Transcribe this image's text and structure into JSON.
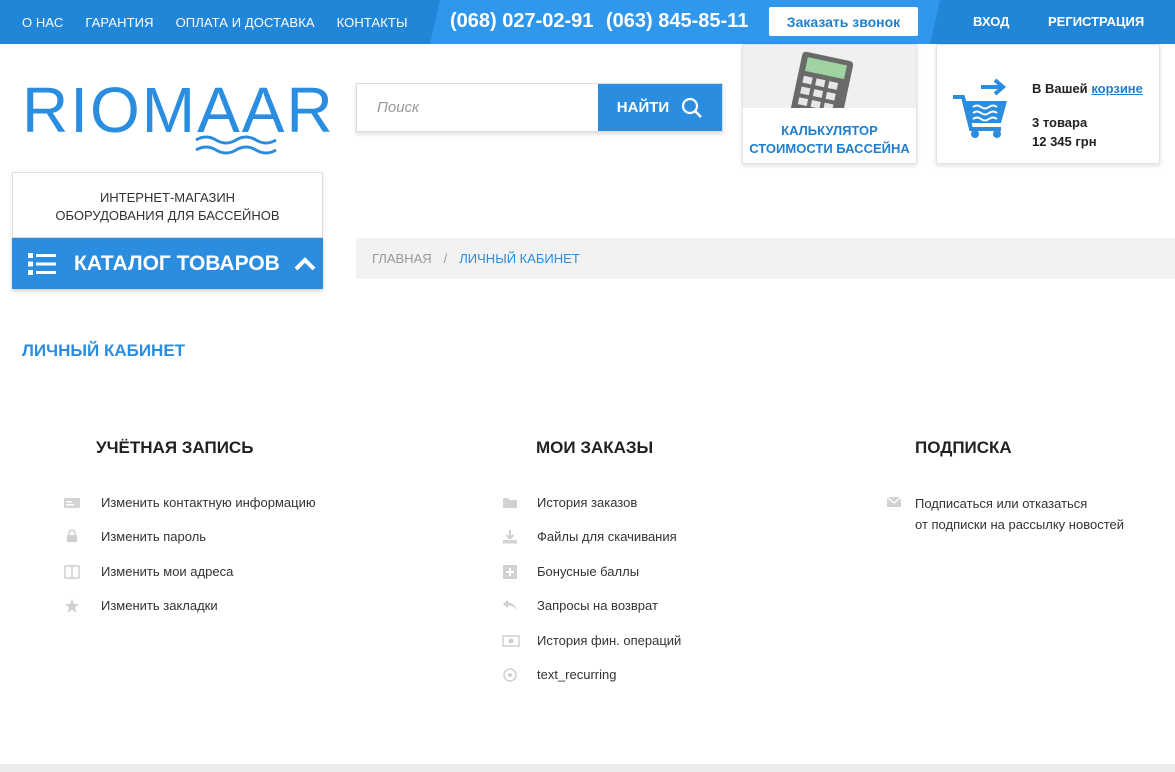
{
  "topbar": {
    "menu": [
      "О НАС",
      "ГАРАНТИЯ",
      "ОПЛАТА И ДОСТАВКА",
      "КОНТАКТЫ"
    ],
    "phone1": "(068) 027-02-91",
    "phone2": "(063) 845-85-11",
    "callback_label": "Заказать звонок",
    "login_label": "ВХОД",
    "register_label": "РЕГИСТРАЦИЯ",
    "color": "#2186d8"
  },
  "logo": {
    "text": "RIOMAAR"
  },
  "shop_description": {
    "line1": "ИНТЕРНЕТ-МАГАЗИН",
    "line2": "ОБОРУДОВАНИЯ ДЛЯ БАССЕЙНОВ"
  },
  "catalog": {
    "label": "КАТАЛОГ ТОВАРОВ",
    "icon": "list-icon"
  },
  "search": {
    "placeholder": "Поиск",
    "button_label": "НАЙТИ"
  },
  "calculator": {
    "line1": "КАЛЬКУЛЯТОР",
    "line2": "СТОИМОСТИ БАССЕЙНА"
  },
  "cart": {
    "prefix": "В Вашей",
    "link": "корзине",
    "count": "3 товара",
    "sum": "12 345 грн"
  },
  "breadcrumb": {
    "home": "ГЛАВНАЯ",
    "separator": "/",
    "current": "ЛИЧНЫЙ КАБИНЕТ"
  },
  "page_title": "ЛИЧНЫЙ КАБИНЕТ",
  "account": {
    "title": "УЧЁТНАЯ ЗАПИСЬ",
    "items": [
      {
        "label": "Изменить контактную информацию",
        "icon": "card-icon"
      },
      {
        "label": "Изменить пароль",
        "icon": "lock-icon"
      },
      {
        "label": "Изменить мои адреса",
        "icon": "book-icon"
      },
      {
        "label": "Изменить закладки",
        "icon": "star-icon"
      }
    ]
  },
  "orders": {
    "title": "МОИ ЗАКАЗЫ",
    "items": [
      {
        "label": "История заказов",
        "icon": "folder-icon"
      },
      {
        "label": "Файлы для скачивания",
        "icon": "download-icon"
      },
      {
        "label": "Бонусные баллы",
        "icon": "plus-square-icon"
      },
      {
        "label": "Запросы на возврат",
        "icon": "return-icon"
      },
      {
        "label": "История фин. операций",
        "icon": "money-icon"
      },
      {
        "label": "text_recurring",
        "icon": "circle-icon"
      }
    ]
  },
  "subscription": {
    "title": "ПОДПИСКА",
    "items": [
      {
        "line1": "Подписаться или отказаться",
        "line2": "от подписки на рассылку новостей",
        "icon": "envelope-icon"
      }
    ]
  },
  "colors": {
    "accent": "#2a8de0",
    "icon_gray": "#c4c4c4"
  }
}
